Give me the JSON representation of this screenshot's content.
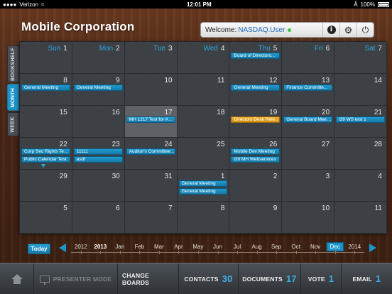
{
  "status_bar": {
    "carrier": "Verizon",
    "time": "12:01 PM",
    "battery": "100%"
  },
  "header": {
    "company": "Mobile Corporation",
    "welcome_prefix": "Welcome:",
    "user": "NASDAQ.User"
  },
  "side_tabs": [
    {
      "label": "BOOKSHELF",
      "active": false
    },
    {
      "label": "MONTH",
      "active": true
    },
    {
      "label": "WEEK",
      "active": false
    }
  ],
  "calendar": {
    "weekdays": [
      "Sun",
      "Mon",
      "Tue",
      "Wed",
      "Thu",
      "Fri",
      "Sat"
    ],
    "weeks": [
      [
        {
          "day": "1",
          "events": []
        },
        {
          "day": "2",
          "events": []
        },
        {
          "day": "3",
          "events": []
        },
        {
          "day": "4",
          "events": []
        },
        {
          "day": "5",
          "events": [
            {
              "title": "Board of Directors...",
              "color": "blue"
            }
          ]
        },
        {
          "day": "6",
          "events": []
        },
        {
          "day": "7",
          "events": []
        }
      ],
      [
        {
          "day": "8",
          "events": [
            {
              "title": "General Meeting",
              "color": "blue"
            }
          ]
        },
        {
          "day": "9",
          "events": [
            {
              "title": "General Meeting",
              "color": "blue"
            }
          ]
        },
        {
          "day": "10",
          "events": []
        },
        {
          "day": "11",
          "events": []
        },
        {
          "day": "12",
          "events": [
            {
              "title": "General Meeting",
              "color": "blue"
            }
          ]
        },
        {
          "day": "13",
          "events": [
            {
              "title": "Finance Committe...",
              "color": "blue"
            }
          ]
        },
        {
          "day": "14",
          "events": []
        }
      ],
      [
        {
          "day": "15",
          "events": []
        },
        {
          "day": "16",
          "events": []
        },
        {
          "day": "17",
          "today": true,
          "events": [
            {
              "title": "MH 1217 Test for An...",
              "color": "blue"
            }
          ]
        },
        {
          "day": "18",
          "events": []
        },
        {
          "day": "19",
          "events": [
            {
              "title": "Directors Desk Rele...",
              "color": "orange"
            }
          ]
        },
        {
          "day": "20",
          "events": [
            {
              "title": "General Board Meeti...",
              "color": "blue"
            }
          ]
        },
        {
          "day": "21",
          "events": [
            {
              "title": "i39 WS test 1",
              "color": "blue"
            }
          ]
        }
      ],
      [
        {
          "day": "22",
          "marker": true,
          "events": [
            {
              "title": "Corp Sec Rights Tes...",
              "color": "blue"
            },
            {
              "title": "Public Calendar Test",
              "color": "blue"
            }
          ]
        },
        {
          "day": "23",
          "events": [
            {
              "title": "11111",
              "color": "blue"
            },
            {
              "title": "asdf",
              "color": "blue"
            }
          ]
        },
        {
          "day": "24",
          "events": [
            {
              "title": "Auditor's Committee...",
              "color": "blue"
            }
          ]
        },
        {
          "day": "25",
          "events": []
        },
        {
          "day": "26",
          "events": [
            {
              "title": "Mobile Dev Meeting",
              "color": "blue"
            },
            {
              "title": "i39 MH Webservices",
              "color": "blue"
            }
          ]
        },
        {
          "day": "27",
          "events": []
        },
        {
          "day": "28",
          "events": []
        }
      ],
      [
        {
          "day": "29",
          "events": []
        },
        {
          "day": "30",
          "events": []
        },
        {
          "day": "31",
          "events": []
        },
        {
          "day": "1",
          "events": [
            {
              "title": "General Meeting",
              "color": "blue"
            },
            {
              "title": "General Meeting",
              "color": "blue"
            }
          ]
        },
        {
          "day": "2",
          "events": []
        },
        {
          "day": "3",
          "events": []
        },
        {
          "day": "4",
          "events": []
        }
      ],
      [
        {
          "day": "5",
          "events": []
        },
        {
          "day": "6",
          "events": []
        },
        {
          "day": "7",
          "events": []
        },
        {
          "day": "8",
          "events": []
        },
        {
          "day": "9",
          "events": []
        },
        {
          "day": "10",
          "events": []
        },
        {
          "day": "11",
          "events": []
        }
      ]
    ]
  },
  "timeline": {
    "today_label": "Today",
    "labels": [
      {
        "text": "2012",
        "style": "normal"
      },
      {
        "text": "2013",
        "style": "bold"
      },
      {
        "text": "Jan",
        "style": "normal"
      },
      {
        "text": "Feb",
        "style": "normal"
      },
      {
        "text": "Mar",
        "style": "normal"
      },
      {
        "text": "Apr",
        "style": "normal"
      },
      {
        "text": "May",
        "style": "normal"
      },
      {
        "text": "Jun",
        "style": "normal"
      },
      {
        "text": "Jul",
        "style": "normal"
      },
      {
        "text": "Aug",
        "style": "normal"
      },
      {
        "text": "Sep",
        "style": "normal"
      },
      {
        "text": "Oct",
        "style": "normal"
      },
      {
        "text": "Nov",
        "style": "normal"
      },
      {
        "text": "Dec",
        "style": "selected"
      },
      {
        "text": "2014",
        "style": "normal"
      }
    ]
  },
  "toolbar": {
    "presenter_mode": "PRESENTER MODE",
    "change_boards": "CHANGE BOARDS",
    "contacts_label": "CONTACTS",
    "contacts_count": "30",
    "documents_label": "DOCUMENTS",
    "documents_count": "17",
    "vote_label": "VOTE",
    "vote_count": "1",
    "email_label": "EMAIL",
    "email_count": "1"
  },
  "colors": {
    "accent": "#1e95c9",
    "event_blue": "#1a8abd",
    "event_orange": "#e5a020",
    "today_cell": "#5e6267"
  }
}
